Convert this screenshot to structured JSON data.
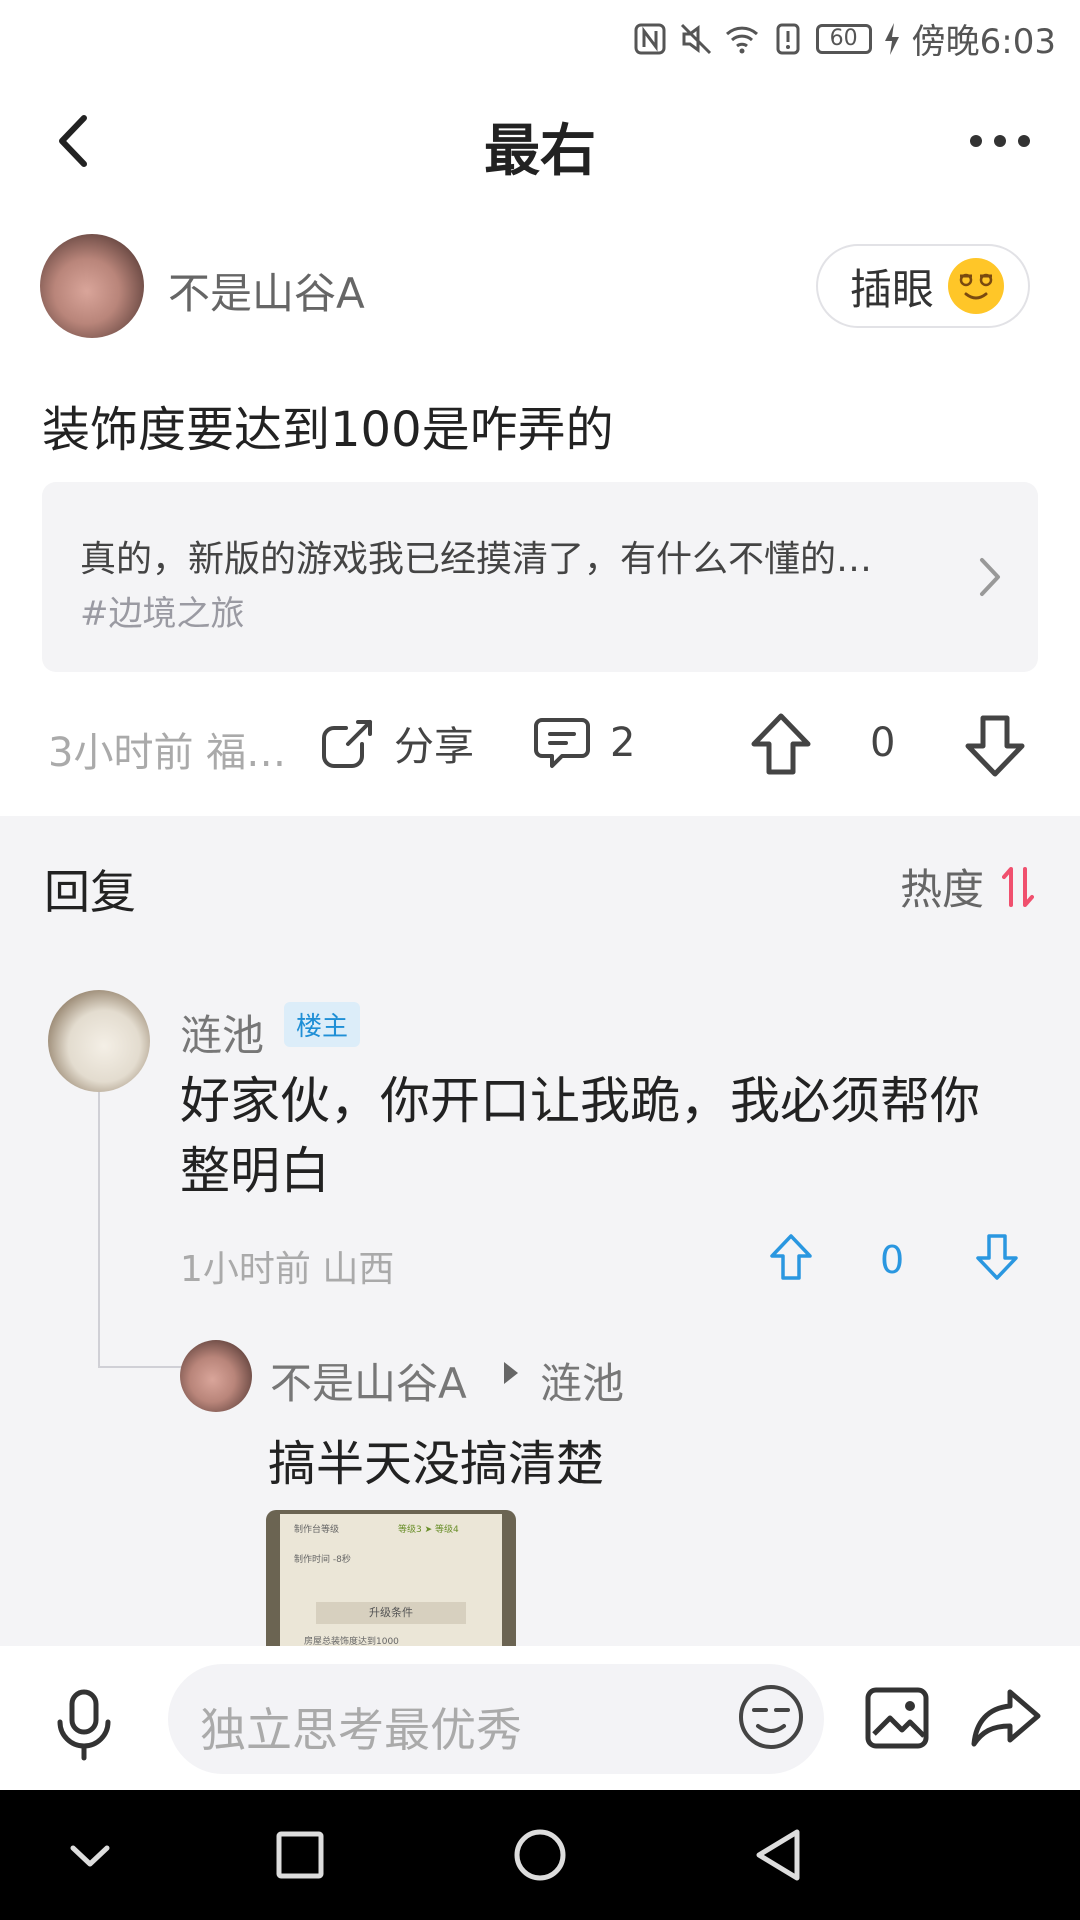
{
  "status_bar": {
    "battery": "60",
    "time": "傍晚6:03"
  },
  "header": {
    "title": "最右"
  },
  "post": {
    "author": "不是山谷A",
    "follow_label": "插眼",
    "title": "装饰度要达到100是咋弄的",
    "quote": {
      "text": "真的，新版的游戏我已经摸清了，有什么不懂的…",
      "tag": "#边境之旅"
    },
    "meta": "3小时前 福…",
    "share_label": "分享",
    "comment_count": "2",
    "vote_count": "0"
  },
  "replies": {
    "heading": "回复",
    "sort_label": "热度",
    "items": [
      {
        "author": "涟池",
        "badge": "楼主",
        "text": "好家伙，你开口让我跪，我必须帮你整明白",
        "meta": "1小时前 山西",
        "vote_count": "0"
      }
    ],
    "sub_reply": {
      "author": "不是山谷A",
      "target": "涟池",
      "text": "搞半天没搞清楚",
      "image_text": {
        "line1": "制作台等级",
        "line2": "等级3 ➤ 等级4",
        "line3": "制作时间 -8秒",
        "bar": "升级条件",
        "condition": "房屋总装饰度达到1000"
      }
    }
  },
  "input_bar": {
    "placeholder": "独立思考最优秀"
  },
  "colors": {
    "accent_blue": "#2a97e0",
    "sort_icon_red": "#f0506e",
    "badge_bg": "#dcedf9"
  }
}
